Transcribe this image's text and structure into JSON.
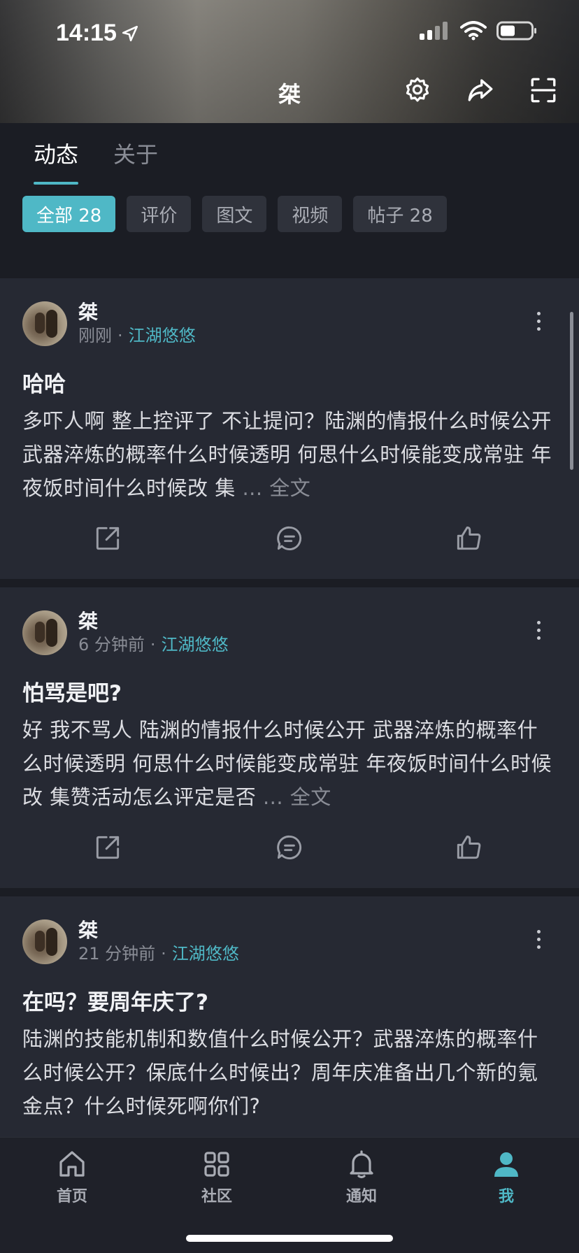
{
  "status_bar": {
    "time": "14:15"
  },
  "header": {
    "title": "桀"
  },
  "tabs": [
    {
      "label": "动态"
    },
    {
      "label": "关于"
    }
  ],
  "filters": [
    {
      "label": "全部 28"
    },
    {
      "label": "评价"
    },
    {
      "label": "图文"
    },
    {
      "label": "视频"
    },
    {
      "label": "帖子 28"
    }
  ],
  "posts": [
    {
      "author": "桀",
      "time": "刚刚",
      "category": "江湖悠悠",
      "title": "哈哈",
      "body": "多吓人啊 整上控评了 不让提问？陆渊的情报什么时候公开 武器淬炼的概率什么时候透明 何思什么时候能变成常驻 年夜饭时间什么时候改 集",
      "read_more": "... 全文"
    },
    {
      "author": "桀",
      "time": "6 分钟前",
      "category": "江湖悠悠",
      "title": "怕骂是吧?",
      "body": "好 我不骂人 陆渊的情报什么时候公开 武器淬炼的概率什么时候透明 何思什么时候能变成常驻 年夜饭时间什么时候改 集赞活动怎么评定是否",
      "read_more": "... 全文"
    },
    {
      "author": "桀",
      "time": "21 分钟前",
      "category": "江湖悠悠",
      "title": "在吗？要周年庆了?",
      "body": "陆渊的技能机制和数值什么时候公开？武器淬炼的概率什么时候公开？保底什么时候出？周年庆准备出几个新的氪金点？什么时候死啊你们?",
      "read_more": ""
    }
  ],
  "bottom_nav": [
    {
      "label": "首页"
    },
    {
      "label": "社区"
    },
    {
      "label": "通知"
    },
    {
      "label": "我"
    }
  ],
  "colors": {
    "accent": "#4fb8c6",
    "background": "#1b1d24",
    "card": "#262933"
  }
}
